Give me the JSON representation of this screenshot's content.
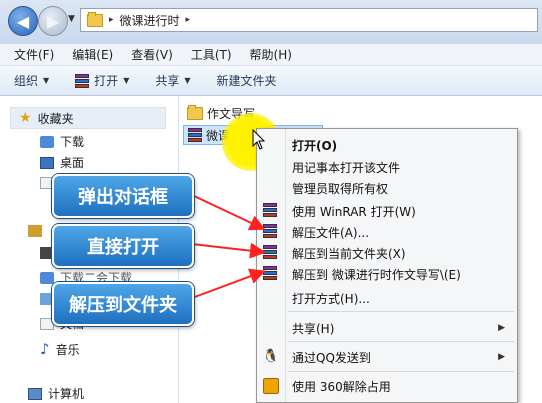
{
  "address": {
    "breadcrumb": "微课进行时",
    "chevron": "▸"
  },
  "menu": {
    "items": [
      "文件(F)",
      "编辑(E)",
      "查看(V)",
      "工具(T)",
      "帮助(H)"
    ]
  },
  "toolbar": {
    "organize": "组织",
    "open": "打开",
    "share": "共享",
    "new_folder": "新建文件夹"
  },
  "sidebar": {
    "favorites": "收藏夹",
    "downloads": "下载",
    "desktop": "桌面",
    "partial_download": "下载二会下载",
    "music": "音乐",
    "partial_doc": "文档",
    "computer": "计算机"
  },
  "files": [
    {
      "name": "作文导写",
      "type": "folder"
    },
    {
      "name": "微课进行时作文导写",
      "type": "rar"
    }
  ],
  "context_menu": {
    "items": [
      "打开(O)",
      "用记事本打开该文件",
      "管理员取得所有权",
      "使用 WinRAR 打开(W)",
      "解压文件(A)...",
      "解压到当前文件夹(X)",
      "解压到 微课进行时作文导写\\(E)",
      "打开方式(H)...",
      "共享(H)",
      "通过QQ发送到",
      "使用 360解除占用"
    ]
  },
  "callouts": {
    "dialog": "弹出对话框",
    "direct": "直接打开",
    "to_folder": "解压到文件夹"
  },
  "colors": {
    "callout_bg": "#2f86d6",
    "arrow": "#ff2020",
    "highlight": "#fff200"
  }
}
